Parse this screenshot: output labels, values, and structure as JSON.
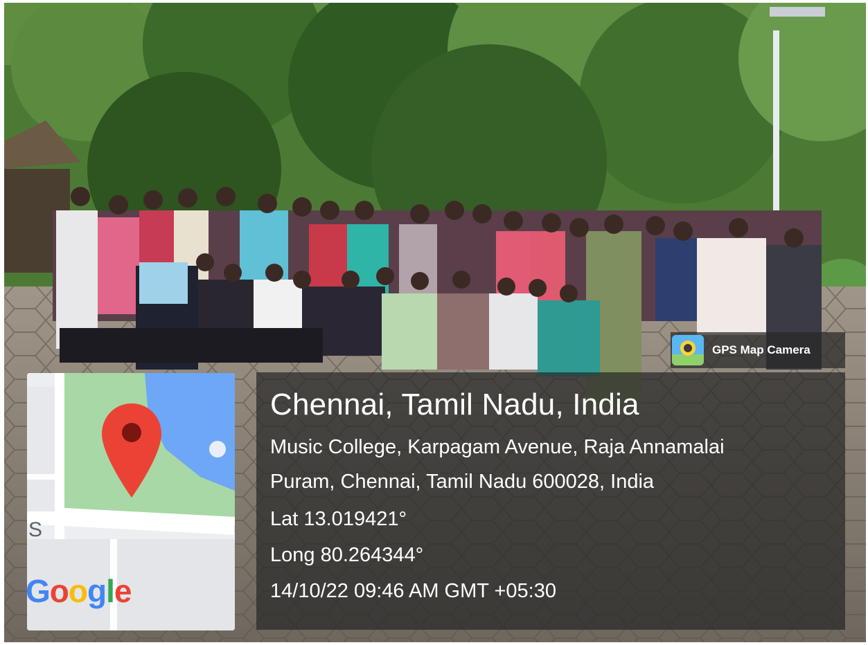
{
  "overlay": {
    "badge_label": "GPS Map Camera",
    "city": "Chennai, Tamil Nadu, India",
    "address_line1": "Music College, Karpagam Avenue, Raja Annamalai",
    "address_line2": "Puram, Chennai, Tamil Nadu 600028, India",
    "latitude": "Lat 13.019421°",
    "longitude": "Long 80.264344°",
    "timestamp": "14/10/22 09:46 AM GMT +05:30"
  },
  "map": {
    "logo_letters": [
      "G",
      "o",
      "o",
      "g",
      "l",
      "e"
    ],
    "logo_colors": [
      "#4285F4",
      "#EA4335",
      "#FBBC05",
      "#4285F4",
      "#34A853",
      "#EA4335"
    ],
    "edge_label": "S",
    "pin_icon": "map-pin-icon",
    "pin_color": "#EA4335"
  },
  "colors": {
    "panel": "#282828",
    "foliage": "#3f6b2e",
    "pavement": "#8b8377"
  }
}
